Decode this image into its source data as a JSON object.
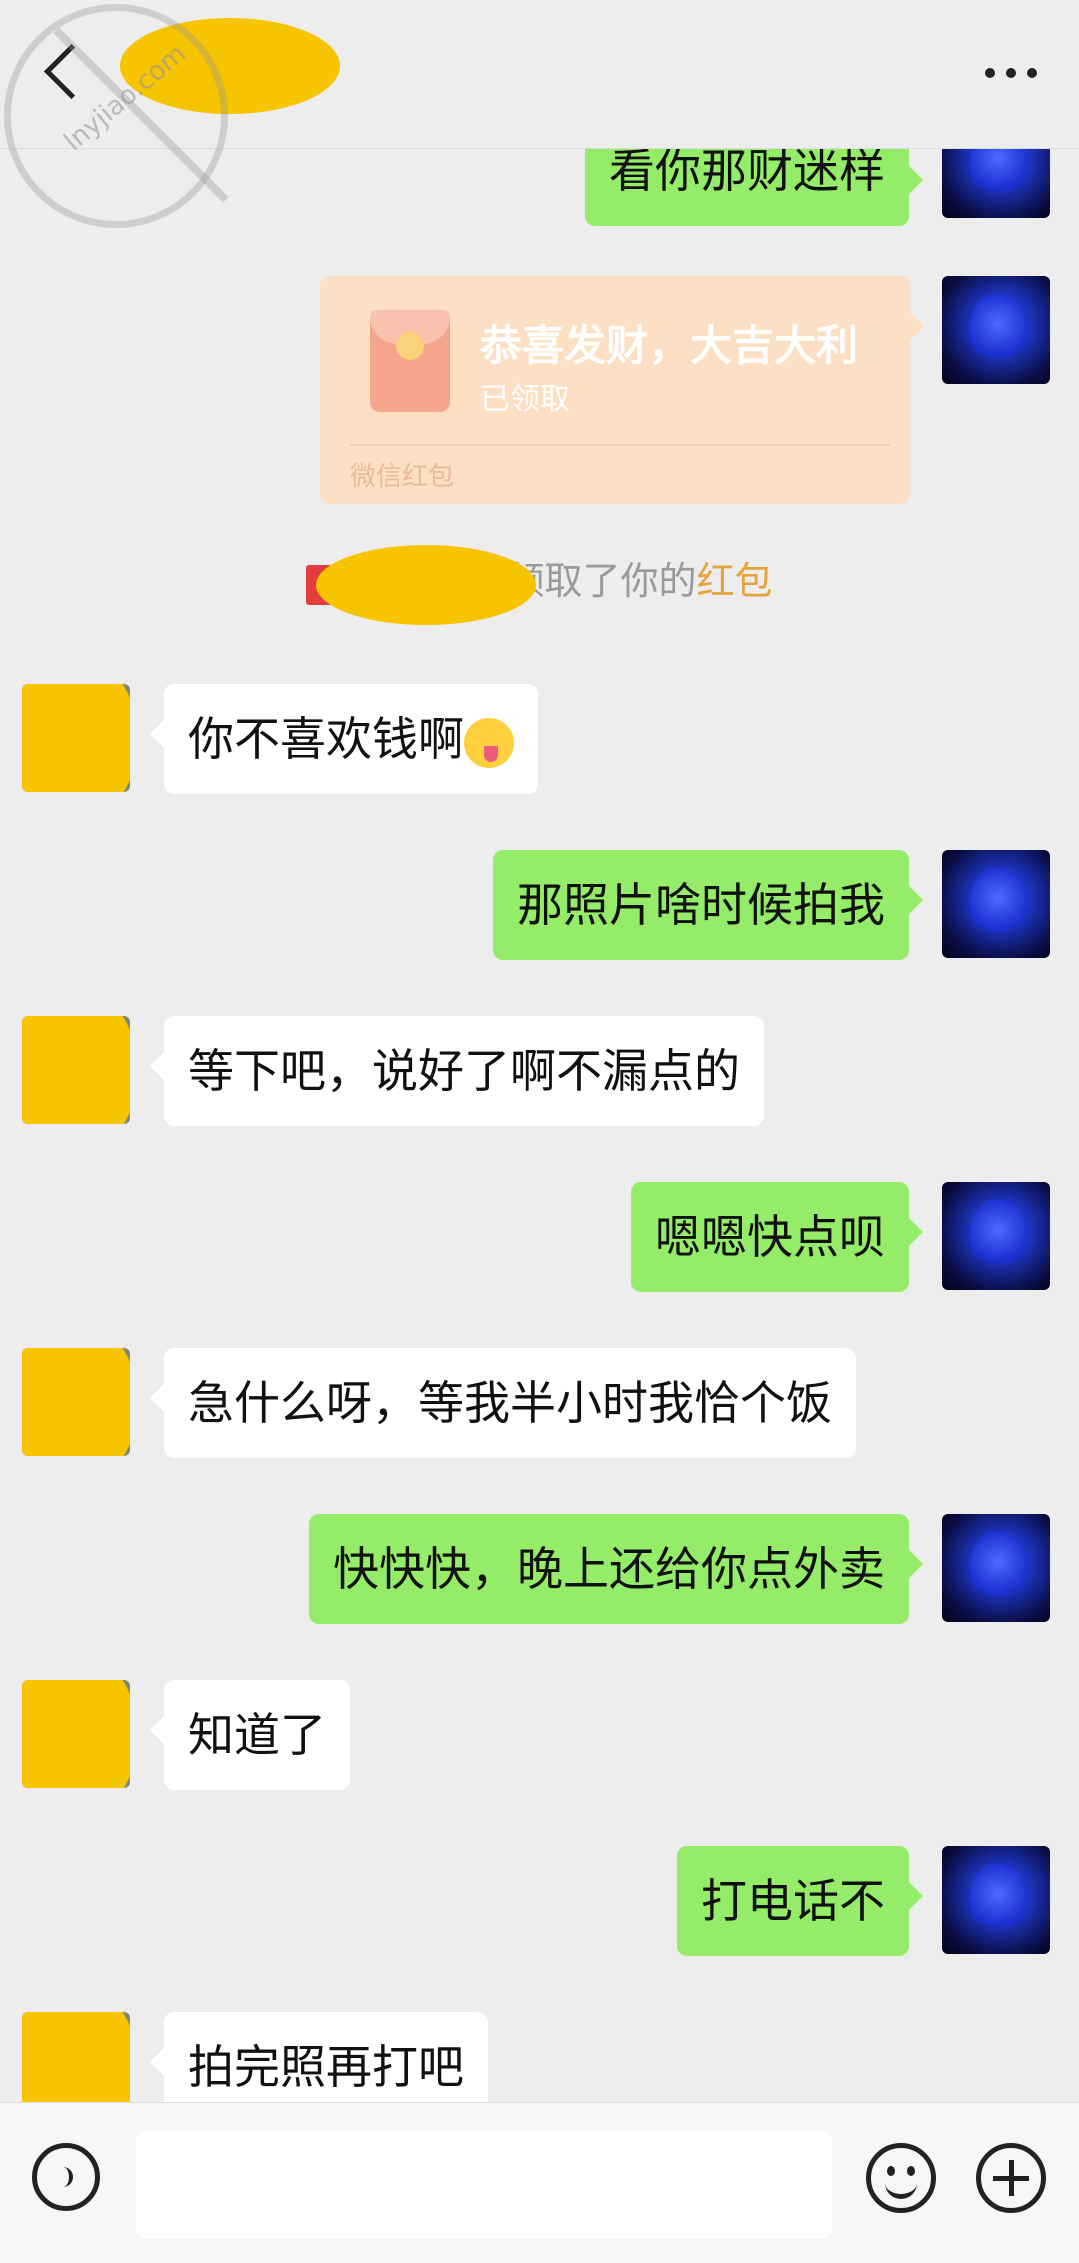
{
  "header": {
    "contact_name": "",
    "more_label": "···"
  },
  "watermark": {
    "text": "lnyjiao.com"
  },
  "messages": [
    {
      "from": "me",
      "text": "看你那财迷样"
    },
    {
      "from": "me",
      "type": "red_packet",
      "greeting": "恭喜发财，大吉大利",
      "status": "已领取",
      "brand": "微信红包"
    },
    {
      "type": "system",
      "text_before": "领取了你的",
      "highlight": "红包"
    },
    {
      "from": "them",
      "text": "你不喜欢钱啊",
      "emoji": "yum-emoji"
    },
    {
      "from": "me",
      "text": "那照片啥时候拍我"
    },
    {
      "from": "them",
      "text": "等下吧，说好了啊不漏点的"
    },
    {
      "from": "me",
      "text": "嗯嗯快点呗"
    },
    {
      "from": "them",
      "text": "急什么呀，等我半小时我恰个饭"
    },
    {
      "from": "me",
      "text": "快快快，晚上还给你点外卖"
    },
    {
      "from": "them",
      "text": "知道了"
    },
    {
      "from": "me",
      "text": "打电话不"
    },
    {
      "from": "them",
      "text": "拍完照再打吧"
    }
  ],
  "input_bar": {
    "placeholder": "",
    "icons": [
      "voice-icon",
      "emoji-icon",
      "plus-icon"
    ]
  }
}
